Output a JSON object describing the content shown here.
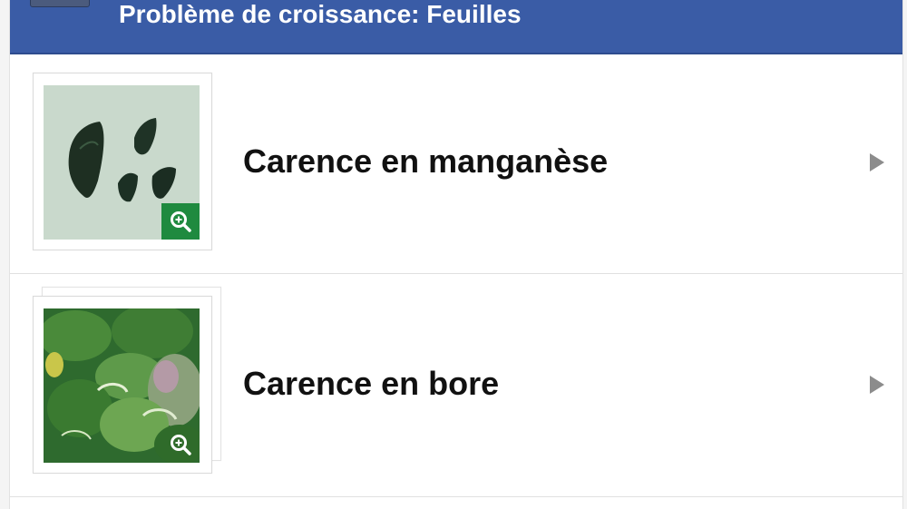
{
  "header": {
    "title": "Problème de croissance: Feuilles"
  },
  "items": [
    {
      "label": "Carence en manganèse",
      "icon": "zoom-in-icon"
    },
    {
      "label": "Carence en bore",
      "icon": "zoom-in-icon"
    }
  ],
  "colors": {
    "header_bg": "#3a5ca6",
    "zoom_badge": "#1f8a3f",
    "chevron": "#8c8c8c"
  }
}
